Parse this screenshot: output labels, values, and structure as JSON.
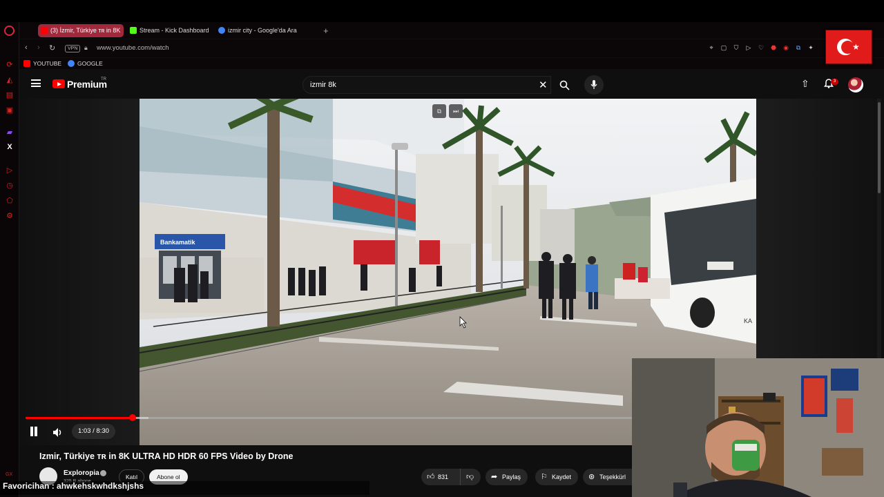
{
  "browser": {
    "tabs": [
      {
        "label": "(3) İzmir, Türkiye ᴛʀ in 8K",
        "color": "#ff0000"
      },
      {
        "label": "Stream - Kick Dashboard",
        "color": "#53fc18"
      },
      {
        "label": "izmir city - Google'da Ara",
        "color": "#4285f4"
      }
    ],
    "new_tab": "+",
    "vpn": "VPN",
    "url": "www.youtube.com/watch",
    "bookmarks": [
      {
        "label": "YOUTUBE",
        "color": "#ff0000"
      },
      {
        "label": "GOOGLE",
        "color": "#4285f4"
      }
    ],
    "sidebar_label": "GX"
  },
  "youtube": {
    "brand": "Premium",
    "region": "TR",
    "search_value": "izmir 8k",
    "notification_count": "3"
  },
  "player": {
    "time": "1:03 / 8:30",
    "progress": 0.1765,
    "buffered": 0.203
  },
  "video": {
    "title": "Izmir, Türkiye ᴛʀ in 8K ULTRA HD HDR 60 FPS Video by Drone",
    "channel": "Exploropia",
    "subscribers": "325 B abone",
    "join_label": "Katıl",
    "subscribe_label": "Abone ol",
    "likes": "831",
    "share_label": "Paylaş",
    "save_label": "Kaydet",
    "thanks_label": "Teşekkürl"
  },
  "overlay": {
    "chat_user": "Favoricihan",
    "chat_message": "ahwkehskwhdkshjshs"
  },
  "scene_signs": {
    "atm_sign": "Bankamatik",
    "bus_text": "KA"
  }
}
